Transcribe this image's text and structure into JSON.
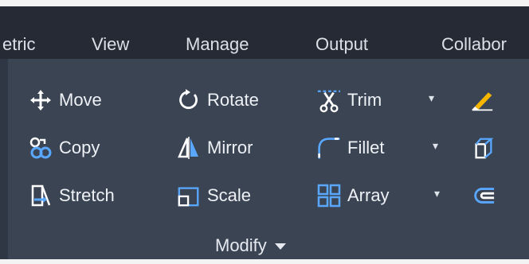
{
  "tabs": [
    {
      "label": "etric"
    },
    {
      "label": "View"
    },
    {
      "label": "Manage"
    },
    {
      "label": "Output"
    },
    {
      "label": "Collabor"
    }
  ],
  "tools": {
    "move": "Move",
    "copy": "Copy",
    "stretch": "Stretch",
    "rotate": "Rotate",
    "mirror": "Mirror",
    "scale": "Scale",
    "trim": "Trim",
    "fillet": "Fillet",
    "array": "Array"
  },
  "panel": {
    "title": "Modify"
  },
  "colors": {
    "tabbar_bg": "#252a35",
    "ribbon_bg": "#3b4453",
    "icon_blue": "#59a7ff",
    "text": "#eef1f5"
  }
}
